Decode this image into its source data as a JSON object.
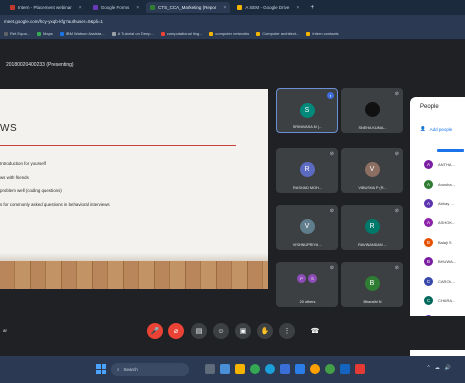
{
  "browser": {
    "tabs": [
      {
        "label": "Intern - Placement webinar",
        "color": "#c0392b",
        "active": false
      },
      {
        "label": "Google Forms",
        "color": "#673ab7",
        "active": false
      },
      {
        "label": "CTS_CCA_Marketing (Repor",
        "color": "#2e7d32",
        "active": true
      },
      {
        "label": "A SEM - Google Drive",
        "color": "#f4b400",
        "active": false
      }
    ],
    "new_tab": "+",
    "url": "meet.google.com/hcy-yxqb-kfg?authuser=0&pli=1",
    "bookmarks": [
      {
        "label": "Ret Equa...",
        "color": "#5f6368"
      },
      {
        "label": "Maps",
        "color": "#34a853"
      },
      {
        "label": "IBM Watson Assista...",
        "color": "#1a73e8"
      },
      {
        "label": "A Tutorial on Deep...",
        "color": "#9aa0a6"
      },
      {
        "label": "computational ling...",
        "color": "#ea4335"
      },
      {
        "label": "computer networks",
        "color": "#f4b400"
      },
      {
        "label": "Computer architect...",
        "color": "#f4b400"
      },
      {
        "label": "Intern contacts",
        "color": "#f4b400"
      }
    ]
  },
  "meeting": {
    "presenting_label": "20180020400233 (Presenting)",
    "slide": {
      "title": "WS",
      "bullets": [
        "Introduction for yourself",
        "ws with friends",
        "problem well (coding questions)",
        "s for commonly asked questions in behavioral interviews"
      ]
    },
    "tiles": [
      {
        "name": "SRINIVASA M (...",
        "initial": "S",
        "avatar_color": "#00897b",
        "speaking": true
      },
      {
        "name": "SNEHA KUMA...",
        "initial": "",
        "avatar_color": "#111111",
        "speaking": false
      },
      {
        "name": "RASHAD MOH...",
        "initial": "R",
        "avatar_color": "#5c6bc0",
        "speaking": false
      },
      {
        "name": "VIBUSHA P (R...",
        "initial": "V",
        "avatar_color": "#8d6e63",
        "speaking": false
      },
      {
        "name": "VISHNUPRIYA ...",
        "initial": "V",
        "avatar_color": "#607d8b",
        "speaking": false
      },
      {
        "name": "RAVINANDAN ...",
        "initial": "R",
        "avatar_color": "#00796b",
        "speaking": false
      },
      {
        "name": "20 others",
        "initial": "",
        "avatar_color": "#8d4cb8",
        "speaking": false,
        "others": [
          "P",
          "S"
        ]
      },
      {
        "name": "Bharathi N",
        "initial": "B",
        "avatar_color": "#2e7d32",
        "speaking": false
      }
    ],
    "people_panel": {
      "title": "People",
      "add_people": "Add people",
      "participants": [
        {
          "initial": "A",
          "name": "ANTHA...",
          "color": "#7b1fa2"
        },
        {
          "initial": "A",
          "name": "Anusha...",
          "color": "#2e7d32"
        },
        {
          "initial": "A",
          "name": "Abhay ...",
          "color": "#5e35b1"
        },
        {
          "initial": "A",
          "name": "ASHOK...",
          "color": "#8e24aa"
        },
        {
          "initial": "B",
          "name": "Balaji S",
          "color": "#e65100"
        },
        {
          "initial": "B",
          "name": "BHUWA...",
          "color": "#7b1fa2"
        },
        {
          "initial": "C",
          "name": "CAROL...",
          "color": "#3949ab"
        },
        {
          "initial": "C",
          "name": "CHARA...",
          "color": "#00695c"
        },
        {
          "initial": "D",
          "name": "DEEP...",
          "color": "#5e35b1"
        }
      ]
    },
    "controls": [
      {
        "name": "mic-button",
        "glyph": "🎤",
        "style": "red"
      },
      {
        "name": "camera-button",
        "glyph": "⌀",
        "style": "red"
      },
      {
        "name": "captions-button",
        "glyph": "▤",
        "style": "grey"
      },
      {
        "name": "emoji-button",
        "glyph": "☺",
        "style": "grey"
      },
      {
        "name": "present-button",
        "glyph": "▣",
        "style": "grey"
      },
      {
        "name": "raise-hand-button",
        "glyph": "✋",
        "style": "grey"
      },
      {
        "name": "more-options-button",
        "glyph": "⋮",
        "style": "grey"
      },
      {
        "name": "end-call-button",
        "glyph": "☎",
        "style": "end"
      }
    ],
    "time_label": "ar"
  },
  "taskbar": {
    "search_placeholder": "Search",
    "tray": [
      "^",
      "☁",
      "🔊"
    ]
  }
}
